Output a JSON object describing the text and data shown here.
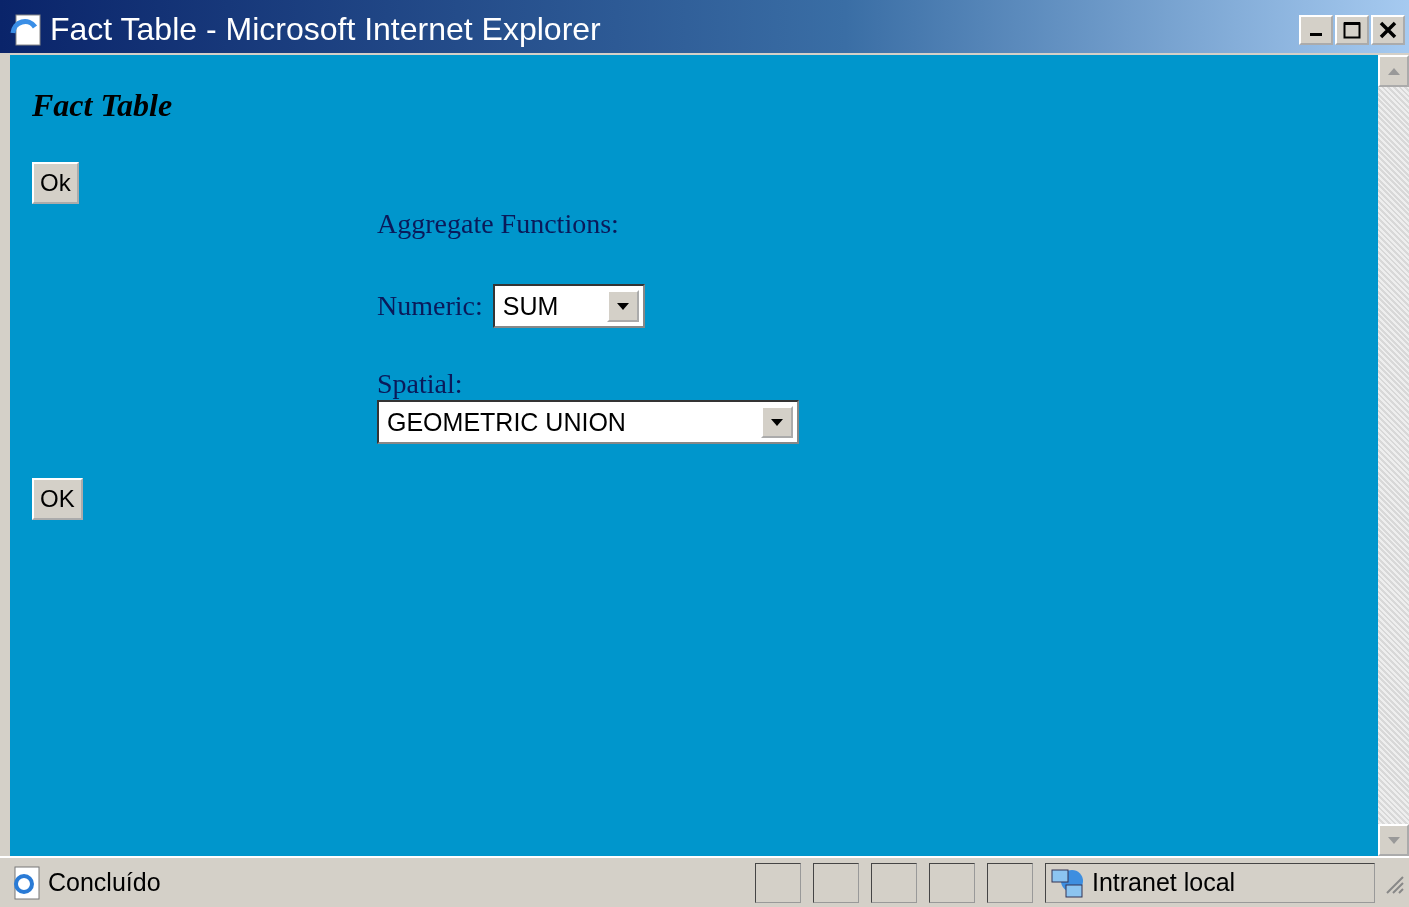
{
  "window": {
    "title": "Fact Table - Microsoft Internet Explorer"
  },
  "page": {
    "heading": "Fact Table",
    "top_button": "Ok",
    "section_label": "Aggregate Functions:",
    "numeric": {
      "label": "Numeric:",
      "value": "SUM"
    },
    "spatial": {
      "label": "Spatial:",
      "value": "GEOMETRIC UNION"
    },
    "bottom_button": "OK"
  },
  "status_bar": {
    "status": "Concluído",
    "zone": "Intranet local"
  }
}
